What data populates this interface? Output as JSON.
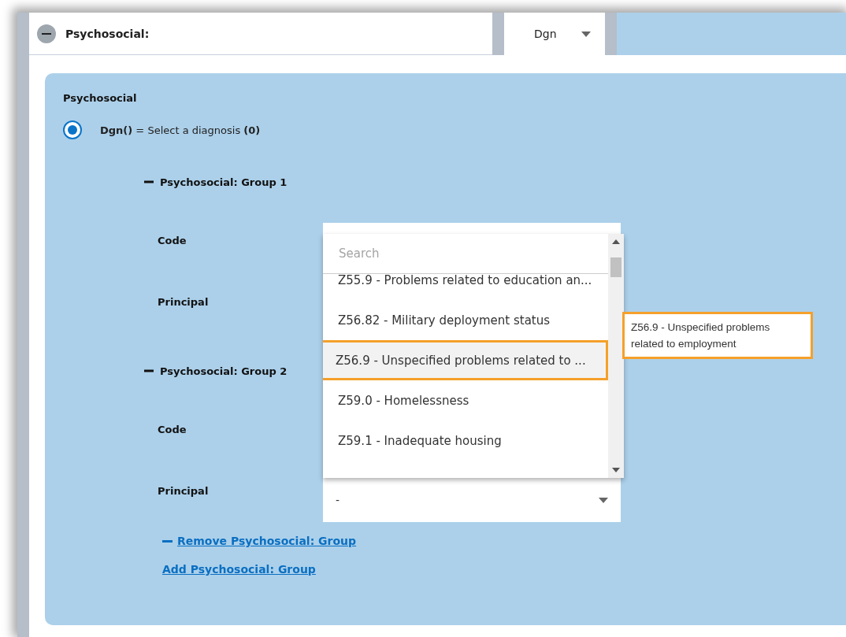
{
  "header": {
    "title": "Psychosocial:",
    "expanded": true,
    "mode_select": {
      "value": "Dgn"
    }
  },
  "panel": {
    "title": "Psychosocial",
    "option": {
      "selected": true,
      "text": "**Dgn()** = Select a diagnosis **(0)**"
    },
    "groups": [
      {
        "heading": "Psychosocial: Group 1",
        "expanded": true,
        "fields": [
          {
            "label": "Code"
          },
          {
            "label": "Principal"
          }
        ]
      },
      {
        "heading": "Psychosocial: Group 2",
        "expanded": true,
        "fields": [
          {
            "label": "Code"
          },
          {
            "label": "Principal",
            "value": "-"
          }
        ]
      }
    ],
    "remove_link": "Remove Psychosocial: Group",
    "add_link": "Add Psychosocial: Group"
  },
  "dropdown": {
    "placeholder": "Search",
    "options": [
      {
        "label": "Z55.9 - Problems related to education an...",
        "highlighted": false
      },
      {
        "label": "Z56.82 - Military deployment status",
        "highlighted": false
      },
      {
        "label": "Z56.9 - Unspecified problems related to ...",
        "highlighted": true
      },
      {
        "label": "Z59.0 - Homelessness",
        "highlighted": false
      },
      {
        "label": "Z59.1 - Inadequate housing",
        "highlighted": false
      }
    ]
  },
  "tooltip": "Z56.9 - Unspecified problems related to employment"
}
